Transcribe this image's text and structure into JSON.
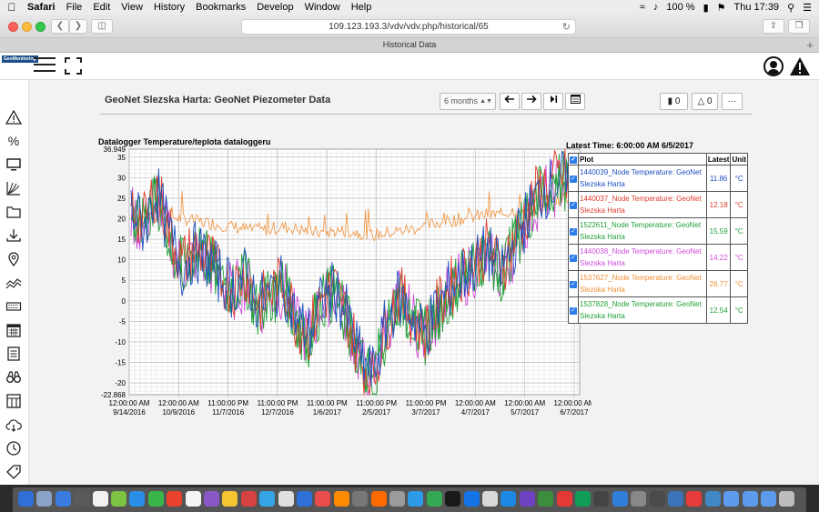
{
  "menubar": {
    "app": "Safari",
    "items": [
      "File",
      "Edit",
      "View",
      "History",
      "Bookmarks",
      "Develop",
      "Window",
      "Help"
    ],
    "battery": "100 %",
    "clock": "Thu 17:39"
  },
  "browser": {
    "url": "109.123.193.3/vdv/vdv.php/historical/65",
    "tab_title": "Historical Data"
  },
  "sidebar": {
    "icons": [
      "alert-icon",
      "percent-icon",
      "monitor-icon",
      "graph-icon",
      "folder-icon",
      "download-icon",
      "location-pin-icon",
      "trend-icon",
      "keyboard-icon",
      "calendar-icon",
      "document-icon",
      "binoculars-icon",
      "layout-icon",
      "cloud-download-icon",
      "clock-icon",
      "tag-icon"
    ]
  },
  "header": {
    "title": "GeoNet Slezska Harta: GeoNet Piezometer Data",
    "range_select": "6 months",
    "messages_count": "0",
    "alerts_count": "0",
    "more_label": "···"
  },
  "chart_data": {
    "type": "line",
    "title": "Datalogger Temperature/teplota dataloggeru",
    "latest_time": "Latest Time: 6:00:00 AM 6/5/2017",
    "ylim": [
      -22.868,
      36.949
    ],
    "yticks": [
      "36.949",
      "35",
      "30",
      "25",
      "20",
      "15",
      "10",
      "5",
      "0",
      "-5",
      "-10",
      "-15",
      "-20",
      "-22.868"
    ],
    "xticks": [
      {
        "time": "12:00:00 AM",
        "date": "9/14/2016"
      },
      {
        "time": "12:00:00 AM",
        "date": "10/9/2016"
      },
      {
        "time": "11:00:00 PM",
        "date": "11/7/2016"
      },
      {
        "time": "11:00:00 PM",
        "date": "12/7/2016"
      },
      {
        "time": "11:00:00 PM",
        "date": "1/6/2017"
      },
      {
        "time": "11:00:00 PM",
        "date": "2/5/2017"
      },
      {
        "time": "11:00:00 PM",
        "date": "3/7/2017"
      },
      {
        "time": "12:00:00 AM",
        "date": "4/7/2017"
      },
      {
        "time": "12:00:00 AM",
        "date": "5/7/2017"
      },
      {
        "time": "12:00:00 AM",
        "date": "6/7/2017"
      }
    ],
    "legend_headers": {
      "plot": "Plot",
      "latest": "Latest",
      "unit": "Unit"
    },
    "series": [
      {
        "name": "1440039_Node Temperature: GeoNet Slezska Harta",
        "latest": "11.86",
        "unit": "°C",
        "color": "#1f4fbf",
        "y": [
          22,
          18,
          27,
          16,
          8,
          12,
          10,
          6,
          3,
          6,
          -1,
          2,
          4,
          -5,
          -8,
          0,
          3,
          -4,
          -14,
          -18,
          -6,
          1,
          -3,
          -8,
          -2,
          3,
          6,
          9,
          12,
          7,
          13,
          20,
          26,
          28,
          30,
          18
        ]
      },
      {
        "name": "1440037_Node Temperature: GeoNet Slezska Harta",
        "latest": "12.18",
        "unit": "°C",
        "color": "#e03c2c",
        "y": [
          23,
          19,
          28,
          17,
          9,
          13,
          11,
          6,
          3,
          7,
          -1,
          2,
          5,
          -5,
          -8,
          1,
          3,
          -4,
          -15,
          -19,
          -6,
          2,
          -3,
          -8,
          -2,
          3,
          7,
          10,
          13,
          8,
          14,
          21,
          27,
          29,
          31,
          19
        ]
      },
      {
        "name": "1522611_Node Temperature: GeoNet Slezska Harta",
        "latest": "15.59",
        "unit": "°C",
        "color": "#22a03a",
        "y": [
          22,
          18,
          26,
          16,
          8,
          12,
          10,
          5,
          3,
          6,
          -2,
          1,
          4,
          -6,
          -9,
          0,
          2,
          -5,
          -15,
          -19,
          -7,
          1,
          -4,
          -9,
          -3,
          2,
          6,
          9,
          12,
          7,
          13,
          20,
          26,
          28,
          30,
          19
        ]
      },
      {
        "name": "1440038_Node Temperature: GeoNet Slezska Harta",
        "latest": "14.22",
        "unit": "°C",
        "color": "#d04ad8",
        "y": [
          21,
          17,
          26,
          15,
          8,
          11,
          9,
          5,
          2,
          5,
          -2,
          1,
          3,
          -6,
          -9,
          0,
          2,
          -5,
          -15,
          -19,
          -7,
          1,
          -4,
          -9,
          -3,
          2,
          5,
          8,
          11,
          6,
          12,
          19,
          25,
          27,
          29,
          18
        ]
      },
      {
        "name": "1537627_Node Temperature: GeoNet Slezska Harta",
        "latest": "26.77",
        "unit": "°C",
        "color": "#f0913a",
        "y": [
          21,
          20,
          20,
          20.5,
          20,
          19.5,
          19,
          18.5,
          18,
          17.5,
          17,
          17.5,
          18,
          17.5,
          17,
          16.5,
          17,
          17,
          16.5,
          16,
          16.5,
          17,
          17.5,
          18,
          19,
          19.5,
          20,
          20.5,
          21,
          21,
          22,
          23,
          24,
          24.5,
          25,
          25
        ]
      },
      {
        "name": "1537828_Node Temperature: GeoNet Slezska Harta",
        "latest": "12.54",
        "unit": "°C",
        "color": "#22a03a",
        "y": [
          22,
          18,
          26,
          16,
          8,
          12,
          10,
          5,
          3,
          6,
          -2,
          1,
          4,
          -6,
          -9,
          0,
          2,
          -5,
          -15,
          -19,
          -7,
          1,
          -4,
          -9,
          -3,
          2,
          6,
          9,
          12,
          7,
          13,
          20,
          26,
          28,
          30,
          19
        ]
      }
    ]
  },
  "dock": {
    "colors": [
      "#2f6fd6",
      "#8aa2c8",
      "#3a7be0",
      "#5a5a5a",
      "#f2f2f2",
      "#7dc242",
      "#2a8ee8",
      "#3ab54a",
      "#e8412c",
      "#f5f5f5",
      "#8a57c7",
      "#f7c531",
      "#d64141",
      "#36a5e8",
      "#e0e0e0",
      "#2e6fd8",
      "#e84c4c",
      "#ff8a00",
      "#777777",
      "#ff6a00",
      "#9b9b9b",
      "#2e9be8",
      "#34a853",
      "#1a1a1a",
      "#1473e6",
      "#d9d9d9",
      "#1e88e5",
      "#6f42c1",
      "#3c8d3c",
      "#e53935",
      "#0f9d58",
      "#444444",
      "#2f7fdb",
      "#888888",
      "#4a4a4a",
      "#3b73b9",
      "#e73c3c",
      "#3f88c5",
      "#5d9cec",
      "#5d9cec",
      "#5d9cec",
      "#bcbcbc"
    ]
  }
}
